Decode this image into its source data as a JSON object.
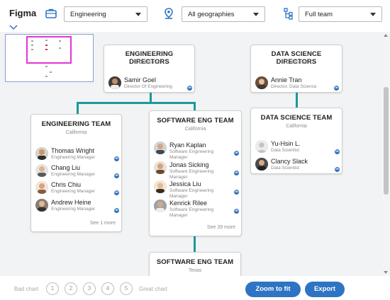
{
  "app": {
    "title": "Figma"
  },
  "filters": {
    "department": "Engineering",
    "geography": "All geographies",
    "team": "Full team"
  },
  "cards": {
    "eng_directors": {
      "title": "ENGINEERING DIRECTORS",
      "location": "California",
      "people": [
        {
          "name": "Samir Goel",
          "role": "Director Of Engineering"
        }
      ]
    },
    "ds_directors": {
      "title": "DATA SCIENCE DIRECTORS",
      "location": "California",
      "people": [
        {
          "name": "Annie Tran",
          "role": "Director, Data Science"
        }
      ]
    },
    "eng_team": {
      "title": "ENGINEERING TEAM",
      "location": "California",
      "people": [
        {
          "name": "Thomas Wright",
          "role": "Engineering Manager"
        },
        {
          "name": "Chang Liu",
          "role": "Engineering Manager"
        },
        {
          "name": "Chris Chiu",
          "role": "Engineering Manager"
        },
        {
          "name": "Andrew Heine",
          "role": "Engineering Manager"
        }
      ],
      "see_more": "See 1 more"
    },
    "sw_team": {
      "title": "SOFTWARE ENG TEAM",
      "location": "California",
      "people": [
        {
          "name": "Ryan Kaplan",
          "role": "Software Engineering Manager"
        },
        {
          "name": "Jonas Sicking",
          "role": "Software Engineering Manager"
        },
        {
          "name": "Jessica Liu",
          "role": "Software Engineering Manager"
        },
        {
          "name": "Kenrick Rilee",
          "role": "Software Engineering Manager"
        }
      ],
      "see_more": "See 39 more"
    },
    "ds_team": {
      "title": "DATA SCIENCE TEAM",
      "location": "California",
      "people": [
        {
          "name": "Yu-Hsin L.",
          "role": "Data Scientist"
        },
        {
          "name": "Clancy Slack",
          "role": "Data Scientist"
        }
      ]
    },
    "sw_team_tx": {
      "title": "SOFTWARE ENG TEAM",
      "location": "Texas"
    }
  },
  "linkedin_glyph": "in",
  "rating": {
    "low_label": "Bad chart",
    "high_label": "Great chart",
    "options": [
      "1",
      "2",
      "3",
      "4",
      "5"
    ]
  },
  "actions": {
    "zoom_to_fit": "Zoom to fit",
    "export": "Export"
  },
  "colors": {
    "accent": "#2f74c4",
    "connector": "#1a9a9a",
    "minimap_viewport": "#e434d2",
    "linkedin": "#2a70bd"
  },
  "icons": [
    "briefcase-icon",
    "location-pin-icon",
    "org-tree-icon",
    "chevron-down-icon",
    "linkedin-icon",
    "avatar-icon"
  ]
}
